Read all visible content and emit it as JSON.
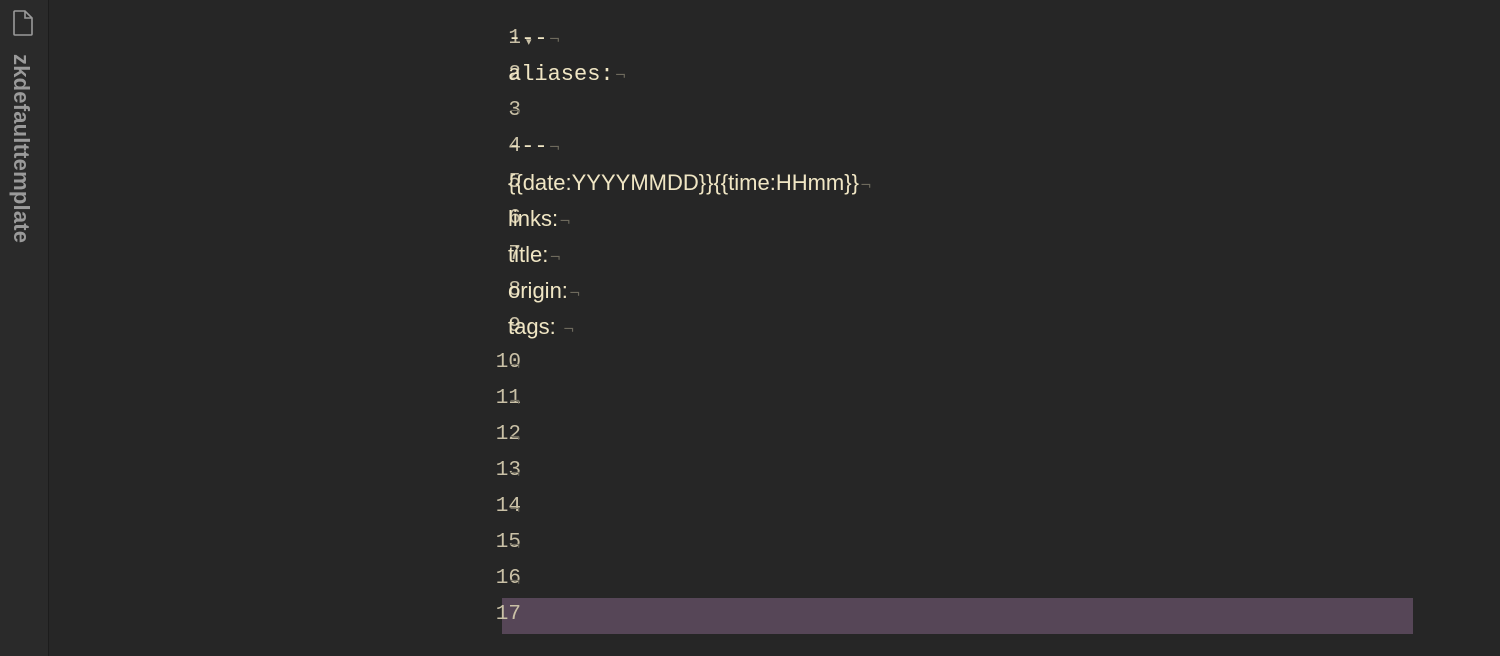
{
  "sidebar": {
    "file_icon": "file-icon",
    "file_title": "zkdefaulttemplate"
  },
  "editor": {
    "eol_marker": "¬",
    "fold_marker": "▾",
    "current_line_color": "#564657",
    "lines": [
      {
        "number": "1",
        "text": "---"
      },
      {
        "number": "2",
        "text": "aliases:"
      },
      {
        "number": "3",
        "text": ""
      },
      {
        "number": "4",
        "text": "---"
      },
      {
        "number": "5",
        "text": "{{date:YYYYMMDD}}{{time:HHmm}}"
      },
      {
        "number": "6",
        "text": "links:"
      },
      {
        "number": "7",
        "text": "title:"
      },
      {
        "number": "8",
        "text": "origin:"
      },
      {
        "number": "9",
        "text": "tags: "
      },
      {
        "number": "10",
        "text": ""
      },
      {
        "number": "11",
        "text": ""
      },
      {
        "number": "12",
        "text": ""
      },
      {
        "number": "13",
        "text": ""
      },
      {
        "number": "14",
        "text": ""
      },
      {
        "number": "15",
        "text": ""
      },
      {
        "number": "16",
        "text": ""
      },
      {
        "number": "17",
        "text": ""
      }
    ]
  }
}
